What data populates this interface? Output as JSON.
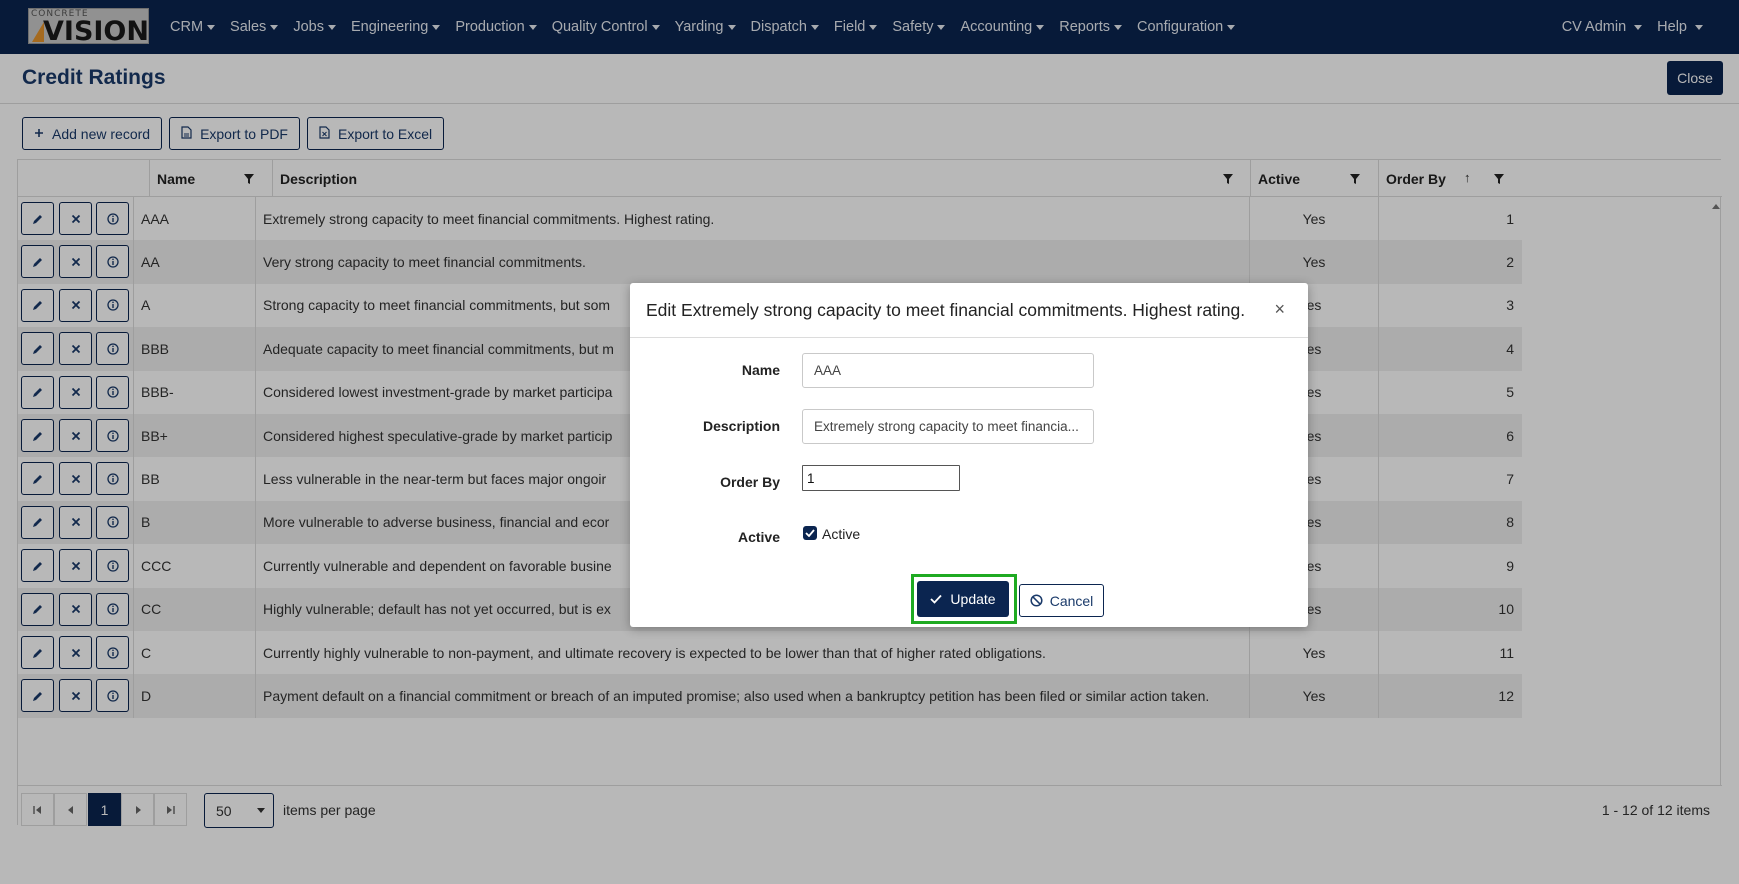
{
  "brand": {
    "logo_small": "CONCRETE",
    "logo_big": "VISION"
  },
  "nav": {
    "items": [
      "CRM",
      "Sales",
      "Jobs",
      "Engineering",
      "Production",
      "Quality Control",
      "Yarding",
      "Dispatch",
      "Field",
      "Safety",
      "Accounting",
      "Reports",
      "Configuration"
    ],
    "user": "CV Admin",
    "help": "Help"
  },
  "page": {
    "title": "Credit Ratings",
    "close_label": "Close"
  },
  "toolbar": {
    "add_label": "Add new record",
    "pdf_label": "Export to PDF",
    "excel_label": "Export to Excel"
  },
  "grid": {
    "columns": {
      "name": "Name",
      "description": "Description",
      "active": "Active",
      "order_by": "Order By"
    },
    "rows": [
      {
        "name": "AAA",
        "description": "Extremely strong capacity to meet financial commitments. Highest rating.",
        "active": "Yes",
        "order": "1"
      },
      {
        "name": "AA",
        "description": "Very strong capacity to meet financial commitments.",
        "active": "Yes",
        "order": "2"
      },
      {
        "name": "A",
        "description": "Strong capacity to meet financial commitments, but som",
        "active": "es",
        "order": "3"
      },
      {
        "name": "BBB",
        "description": "Adequate capacity to meet financial commitments, but m",
        "active": "es",
        "order": "4"
      },
      {
        "name": "BBB-",
        "description": "Considered lowest investment-grade by market participa",
        "active": "es",
        "order": "5"
      },
      {
        "name": "BB+",
        "description": "Considered highest speculative-grade by market particip",
        "active": "es",
        "order": "6"
      },
      {
        "name": "BB",
        "description": "Less vulnerable in the near-term but faces major ongoir",
        "active": "es",
        "order": "7"
      },
      {
        "name": "B",
        "description": "More vulnerable to adverse business, financial and ecor",
        "active": "es",
        "order": "8"
      },
      {
        "name": "CCC",
        "description": "Currently vulnerable and dependent on favorable busine",
        "active": "es",
        "order": "9"
      },
      {
        "name": "CC",
        "description": "Highly vulnerable; default has not yet occurred, but is ex",
        "active": "es",
        "order": "10"
      },
      {
        "name": "C",
        "description": "Currently highly vulnerable to non-payment, and ultimate recovery is expected to be lower than that of higher rated obligations.",
        "active": "Yes",
        "order": "11"
      },
      {
        "name": "D",
        "description": "Payment default on a financial commitment or breach of an imputed promise; also used when a bankruptcy petition has been filed or similar action taken.",
        "active": "Yes",
        "order": "12"
      }
    ]
  },
  "pager": {
    "current_page": "1",
    "page_size": "50",
    "items_per_page_label": "items per page",
    "info": "1 - 12 of 12 items"
  },
  "modal": {
    "title": "Edit Extremely strong capacity to meet financial commitments. Highest rating.",
    "close_symbol": "×",
    "name_label": "Name",
    "name_value": "AAA",
    "description_label": "Description",
    "description_value": "Extremely strong capacity to meet financia...",
    "order_label": "Order By",
    "order_value": "1",
    "active_label": "Active",
    "active_checkbox_label": "Active",
    "active_checked": true,
    "update_label": "Update",
    "cancel_label": "Cancel"
  },
  "colors": {
    "navy": "#0b2550",
    "highlight": "#1faa22",
    "row_alt": "#efefef"
  }
}
